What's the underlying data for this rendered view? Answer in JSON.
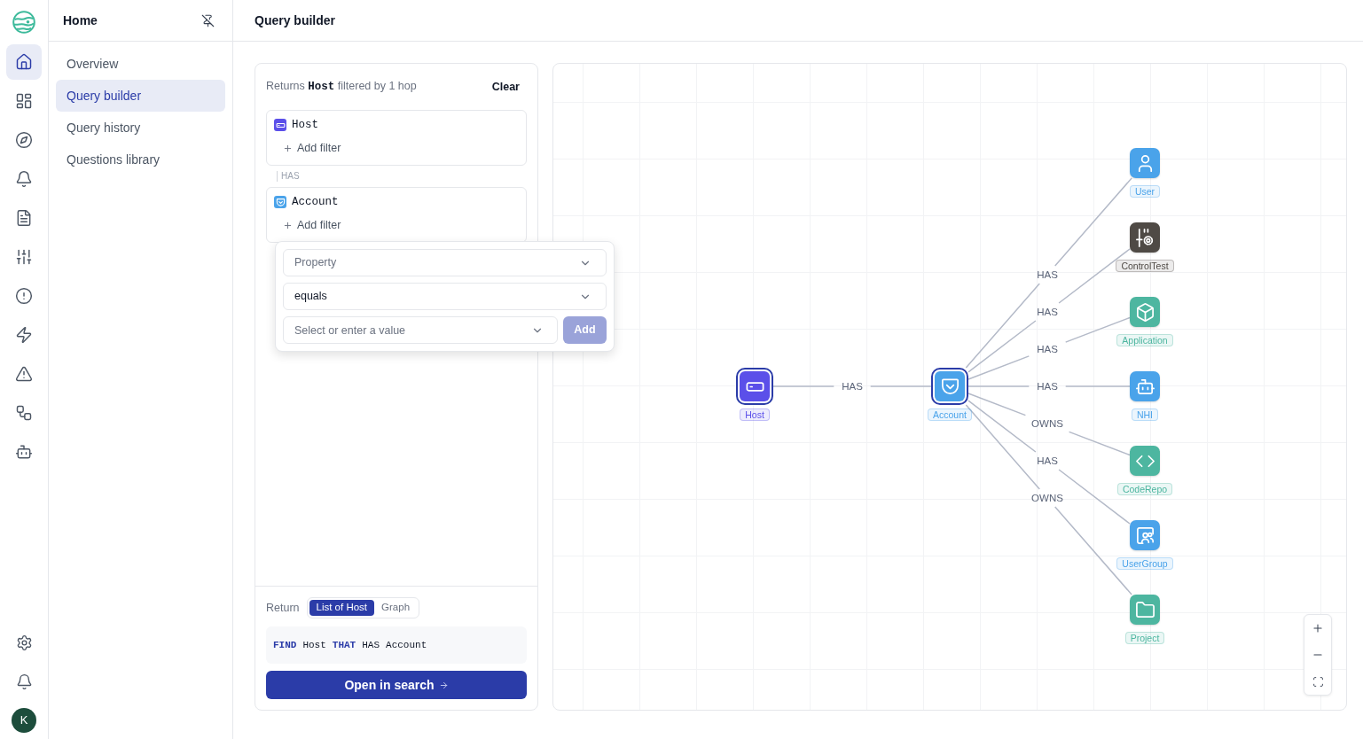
{
  "rail": {
    "items": [
      {
        "selected": true
      },
      {
        "selected": false
      },
      {
        "selected": false
      },
      {
        "selected": false
      },
      {
        "selected": false
      },
      {
        "selected": false
      },
      {
        "selected": false
      },
      {
        "selected": false
      },
      {
        "selected": false
      },
      {
        "selected": false
      },
      {
        "selected": false
      }
    ],
    "avatar": "K"
  },
  "sidebar": {
    "title": "Home",
    "items": [
      {
        "label": "Overview",
        "selected": false
      },
      {
        "label": "Query builder",
        "selected": true
      },
      {
        "label": "Query history",
        "selected": false
      },
      {
        "label": "Questions library",
        "selected": false
      }
    ]
  },
  "page": {
    "title": "Query builder"
  },
  "query": {
    "summary": {
      "prefix": "Returns",
      "entity": "Host",
      "suffix": "filtered by 1 hop"
    },
    "clear": "Clear",
    "entities": [
      {
        "kind": "host",
        "name": "Host",
        "color": "#5b4fe9",
        "add_filter": "Add filter"
      },
      {
        "kind": "account",
        "name": "Account",
        "color": "#4aa3ea",
        "relation": "HAS",
        "add_filter": "Add filter",
        "filter_popover": {
          "property": {
            "placeholder": "Property"
          },
          "operator": {
            "value": "equals"
          },
          "value": {
            "placeholder": "Select or enter a value"
          },
          "add_button": {
            "label": "Add",
            "disabled": true
          }
        }
      }
    ],
    "return": {
      "label": "Return",
      "options": [
        {
          "label": "List of Host",
          "selected": true
        },
        {
          "label": "Graph",
          "selected": false
        }
      ]
    },
    "query_text": [
      {
        "text": "FIND",
        "keyword": true
      },
      {
        "text": "Host",
        "keyword": false
      },
      {
        "text": "THAT",
        "keyword": true
      },
      {
        "text": "HAS",
        "keyword": false
      },
      {
        "text": "Account",
        "keyword": false
      }
    ],
    "open_button": "Open in search"
  },
  "graph": {
    "root": {
      "label": "Host",
      "kind": "host",
      "color": "#5b4fe9",
      "selected": true,
      "relations": [
        {
          "label": "HAS",
          "node": {
            "label": "Account",
            "kind": "account",
            "color": "#4aa3ea",
            "selected": true,
            "relations": [
              {
                "label": "HAS",
                "node": {
                  "label": "User",
                  "kind": "user",
                  "color": "#4aa3ea",
                  "selected": false
                }
              },
              {
                "label": "HAS",
                "node": {
                  "label": "ControlTest",
                  "kind": "control_test",
                  "color": "#4f4a45",
                  "selected": false
                }
              },
              {
                "label": "HAS",
                "node": {
                  "label": "Application",
                  "kind": "application",
                  "color": "#4db6a0",
                  "selected": false
                }
              },
              {
                "label": "HAS",
                "node": {
                  "label": "NHI",
                  "kind": "nhi",
                  "color": "#4aa3ea",
                  "selected": false
                }
              },
              {
                "label": "OWNS",
                "node": {
                  "label": "CodeRepo",
                  "kind": "code_repo",
                  "color": "#4db6a0",
                  "selected": false
                }
              },
              {
                "label": "HAS",
                "node": {
                  "label": "UserGroup",
                  "kind": "user_group",
                  "color": "#4aa3ea",
                  "selected": false
                }
              },
              {
                "label": "OWNS",
                "node": {
                  "label": "Project",
                  "kind": "project",
                  "color": "#4db6a0",
                  "selected": false
                }
              }
            ]
          }
        }
      ]
    }
  }
}
